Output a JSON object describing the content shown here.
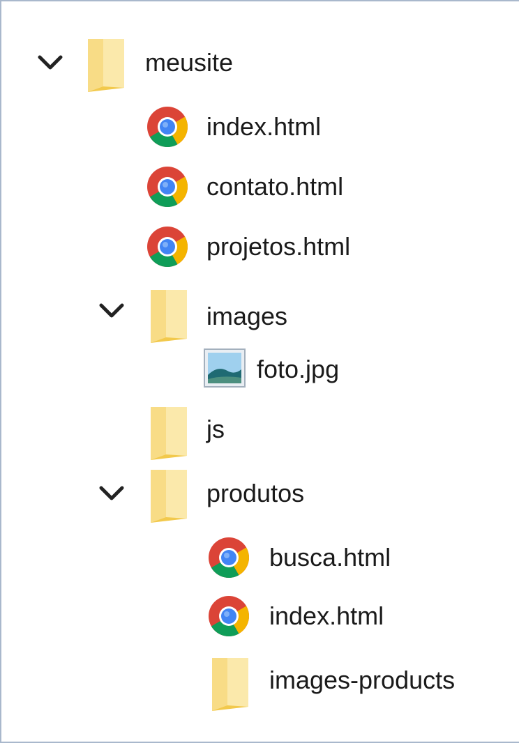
{
  "tree": {
    "items": [
      {
        "label": "meusite",
        "icon": "folder-icon",
        "expanded": true
      },
      {
        "label": "index.html",
        "icon": "chrome-icon"
      },
      {
        "label": "contato.html",
        "icon": "chrome-icon"
      },
      {
        "label": "projetos.html",
        "icon": "chrome-icon"
      },
      {
        "label": "images",
        "icon": "folder-icon",
        "expanded": true
      },
      {
        "label": "foto.jpg",
        "icon": "image-file-icon"
      },
      {
        "label": "js",
        "icon": "folder-icon"
      },
      {
        "label": "produtos",
        "icon": "folder-icon",
        "expanded": true
      },
      {
        "label": "busca.html",
        "icon": "chrome-icon"
      },
      {
        "label": "index.html",
        "icon": "chrome-icon"
      },
      {
        "label": "images-products",
        "icon": "folder-icon"
      }
    ]
  },
  "colors": {
    "folder": "#f7d774",
    "folder_light": "#fbe7a6",
    "chrome_red": "#db4437",
    "chrome_green": "#0f9d58",
    "chrome_yellow": "#f4b400",
    "chrome_blue": "#4285f4",
    "border": "#a9b8cc"
  }
}
